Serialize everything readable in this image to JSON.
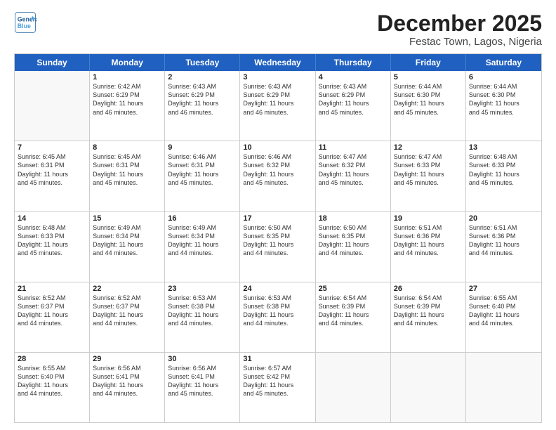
{
  "logo": {
    "line1": "General",
    "line2": "Blue"
  },
  "title": "December 2025",
  "subtitle": "Festac Town, Lagos, Nigeria",
  "header_days": [
    "Sunday",
    "Monday",
    "Tuesday",
    "Wednesday",
    "Thursday",
    "Friday",
    "Saturday"
  ],
  "rows": [
    [
      {
        "day": "",
        "info": ""
      },
      {
        "day": "1",
        "info": "Sunrise: 6:42 AM\nSunset: 6:29 PM\nDaylight: 11 hours\nand 46 minutes."
      },
      {
        "day": "2",
        "info": "Sunrise: 6:43 AM\nSunset: 6:29 PM\nDaylight: 11 hours\nand 46 minutes."
      },
      {
        "day": "3",
        "info": "Sunrise: 6:43 AM\nSunset: 6:29 PM\nDaylight: 11 hours\nand 46 minutes."
      },
      {
        "day": "4",
        "info": "Sunrise: 6:43 AM\nSunset: 6:29 PM\nDaylight: 11 hours\nand 45 minutes."
      },
      {
        "day": "5",
        "info": "Sunrise: 6:44 AM\nSunset: 6:30 PM\nDaylight: 11 hours\nand 45 minutes."
      },
      {
        "day": "6",
        "info": "Sunrise: 6:44 AM\nSunset: 6:30 PM\nDaylight: 11 hours\nand 45 minutes."
      }
    ],
    [
      {
        "day": "7",
        "info": "Sunrise: 6:45 AM\nSunset: 6:31 PM\nDaylight: 11 hours\nand 45 minutes."
      },
      {
        "day": "8",
        "info": "Sunrise: 6:45 AM\nSunset: 6:31 PM\nDaylight: 11 hours\nand 45 minutes."
      },
      {
        "day": "9",
        "info": "Sunrise: 6:46 AM\nSunset: 6:31 PM\nDaylight: 11 hours\nand 45 minutes."
      },
      {
        "day": "10",
        "info": "Sunrise: 6:46 AM\nSunset: 6:32 PM\nDaylight: 11 hours\nand 45 minutes."
      },
      {
        "day": "11",
        "info": "Sunrise: 6:47 AM\nSunset: 6:32 PM\nDaylight: 11 hours\nand 45 minutes."
      },
      {
        "day": "12",
        "info": "Sunrise: 6:47 AM\nSunset: 6:33 PM\nDaylight: 11 hours\nand 45 minutes."
      },
      {
        "day": "13",
        "info": "Sunrise: 6:48 AM\nSunset: 6:33 PM\nDaylight: 11 hours\nand 45 minutes."
      }
    ],
    [
      {
        "day": "14",
        "info": "Sunrise: 6:48 AM\nSunset: 6:33 PM\nDaylight: 11 hours\nand 45 minutes."
      },
      {
        "day": "15",
        "info": "Sunrise: 6:49 AM\nSunset: 6:34 PM\nDaylight: 11 hours\nand 44 minutes."
      },
      {
        "day": "16",
        "info": "Sunrise: 6:49 AM\nSunset: 6:34 PM\nDaylight: 11 hours\nand 44 minutes."
      },
      {
        "day": "17",
        "info": "Sunrise: 6:50 AM\nSunset: 6:35 PM\nDaylight: 11 hours\nand 44 minutes."
      },
      {
        "day": "18",
        "info": "Sunrise: 6:50 AM\nSunset: 6:35 PM\nDaylight: 11 hours\nand 44 minutes."
      },
      {
        "day": "19",
        "info": "Sunrise: 6:51 AM\nSunset: 6:36 PM\nDaylight: 11 hours\nand 44 minutes."
      },
      {
        "day": "20",
        "info": "Sunrise: 6:51 AM\nSunset: 6:36 PM\nDaylight: 11 hours\nand 44 minutes."
      }
    ],
    [
      {
        "day": "21",
        "info": "Sunrise: 6:52 AM\nSunset: 6:37 PM\nDaylight: 11 hours\nand 44 minutes."
      },
      {
        "day": "22",
        "info": "Sunrise: 6:52 AM\nSunset: 6:37 PM\nDaylight: 11 hours\nand 44 minutes."
      },
      {
        "day": "23",
        "info": "Sunrise: 6:53 AM\nSunset: 6:38 PM\nDaylight: 11 hours\nand 44 minutes."
      },
      {
        "day": "24",
        "info": "Sunrise: 6:53 AM\nSunset: 6:38 PM\nDaylight: 11 hours\nand 44 minutes."
      },
      {
        "day": "25",
        "info": "Sunrise: 6:54 AM\nSunset: 6:39 PM\nDaylight: 11 hours\nand 44 minutes."
      },
      {
        "day": "26",
        "info": "Sunrise: 6:54 AM\nSunset: 6:39 PM\nDaylight: 11 hours\nand 44 minutes."
      },
      {
        "day": "27",
        "info": "Sunrise: 6:55 AM\nSunset: 6:40 PM\nDaylight: 11 hours\nand 44 minutes."
      }
    ],
    [
      {
        "day": "28",
        "info": "Sunrise: 6:55 AM\nSunset: 6:40 PM\nDaylight: 11 hours\nand 44 minutes."
      },
      {
        "day": "29",
        "info": "Sunrise: 6:56 AM\nSunset: 6:41 PM\nDaylight: 11 hours\nand 44 minutes."
      },
      {
        "day": "30",
        "info": "Sunrise: 6:56 AM\nSunset: 6:41 PM\nDaylight: 11 hours\nand 45 minutes."
      },
      {
        "day": "31",
        "info": "Sunrise: 6:57 AM\nSunset: 6:42 PM\nDaylight: 11 hours\nand 45 minutes."
      },
      {
        "day": "",
        "info": ""
      },
      {
        "day": "",
        "info": ""
      },
      {
        "day": "",
        "info": ""
      }
    ]
  ]
}
